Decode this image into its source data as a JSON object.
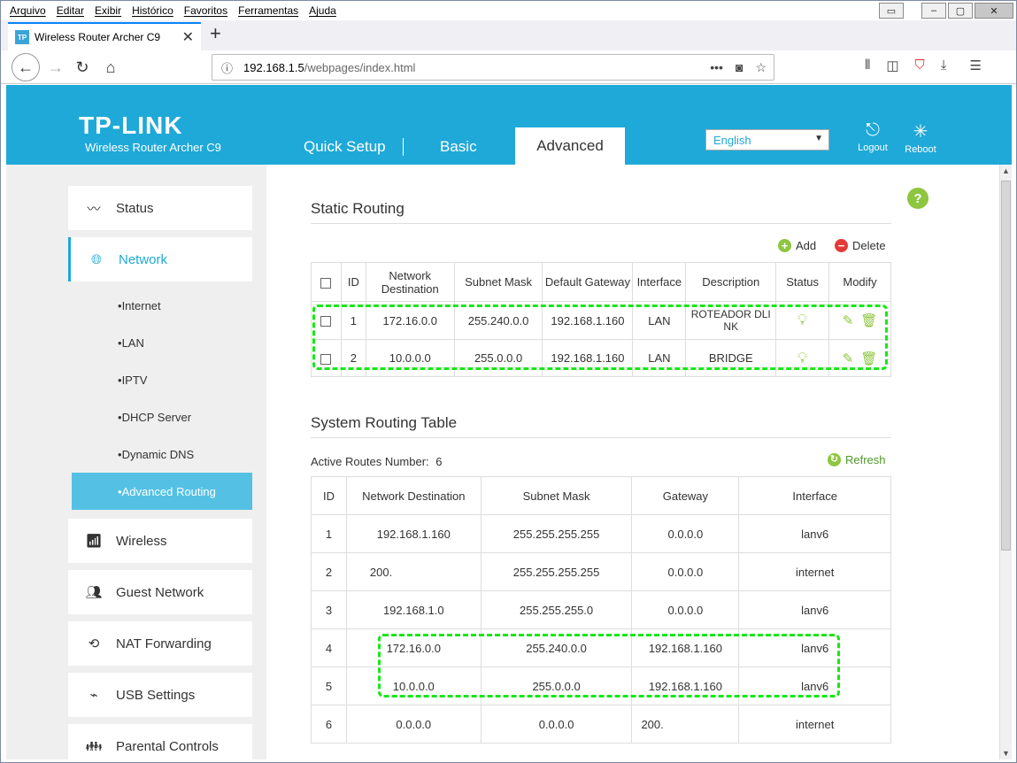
{
  "browser": {
    "menu": [
      "Arquivo",
      "Editar",
      "Exibir",
      "Histórico",
      "Favoritos",
      "Ferramentas",
      "Ajuda"
    ],
    "tab_title": "Wireless Router Archer C9",
    "favicon_text": "TP",
    "url_host": "192.168.1.5",
    "url_path": "/webpages/index.html"
  },
  "header": {
    "logo": "TP-LINK",
    "model": "Wireless Router Archer C9",
    "tabs": [
      "Quick Setup",
      "Basic",
      "Advanced"
    ],
    "language": "English",
    "logout": "Logout",
    "reboot": "Reboot"
  },
  "sidebar": {
    "items": [
      "Status",
      "Network",
      "Wireless",
      "Guest Network",
      "NAT Forwarding",
      "USB Settings",
      "Parental Controls"
    ],
    "network_sub": [
      "Internet",
      "LAN",
      "IPTV",
      "DHCP Server",
      "Dynamic DNS",
      "Advanced Routing"
    ]
  },
  "static_routing": {
    "title": "Static Routing",
    "add_label": "Add",
    "delete_label": "Delete",
    "headers": [
      "ID",
      "Network Destination",
      "Subnet Mask",
      "Default Gateway",
      "Interface",
      "Description",
      "Status",
      "Modify"
    ],
    "rows": [
      {
        "id": "1",
        "dest": "172.16.0.0",
        "mask": "255.240.0.0",
        "gw": "192.168.1.160",
        "iface": "LAN",
        "desc": "ROTEADOR DLINK"
      },
      {
        "id": "2",
        "dest": "10.0.0.0",
        "mask": "255.0.0.0",
        "gw": "192.168.1.160",
        "iface": "LAN",
        "desc": "BRIDGE"
      }
    ]
  },
  "system_routing": {
    "title": "System Routing Table",
    "active_label": "Active Routes Number:",
    "active_count": "6",
    "refresh_label": "Refresh",
    "headers": [
      "ID",
      "Network Destination",
      "Subnet Mask",
      "Gateway",
      "Interface"
    ],
    "rows": [
      {
        "id": "1",
        "dest": "192.168.1.160",
        "mask": "255.255.255.255",
        "gw": "0.0.0.0",
        "iface": "lanv6"
      },
      {
        "id": "2",
        "dest": "200.",
        "mask": "255.255.255.255",
        "gw": "0.0.0.0",
        "iface": "internet"
      },
      {
        "id": "3",
        "dest": "192.168.1.0",
        "mask": "255.255.255.0",
        "gw": "0.0.0.0",
        "iface": "lanv6"
      },
      {
        "id": "4",
        "dest": "172.16.0.0",
        "mask": "255.240.0.0",
        "gw": "192.168.1.160",
        "iface": "lanv6"
      },
      {
        "id": "5",
        "dest": "10.0.0.0",
        "mask": "255.0.0.0",
        "gw": "192.168.1.160",
        "iface": "lanv6"
      },
      {
        "id": "6",
        "dest": "0.0.0.0",
        "mask": "0.0.0.0",
        "gw": "200.",
        "iface": "internet"
      }
    ]
  }
}
